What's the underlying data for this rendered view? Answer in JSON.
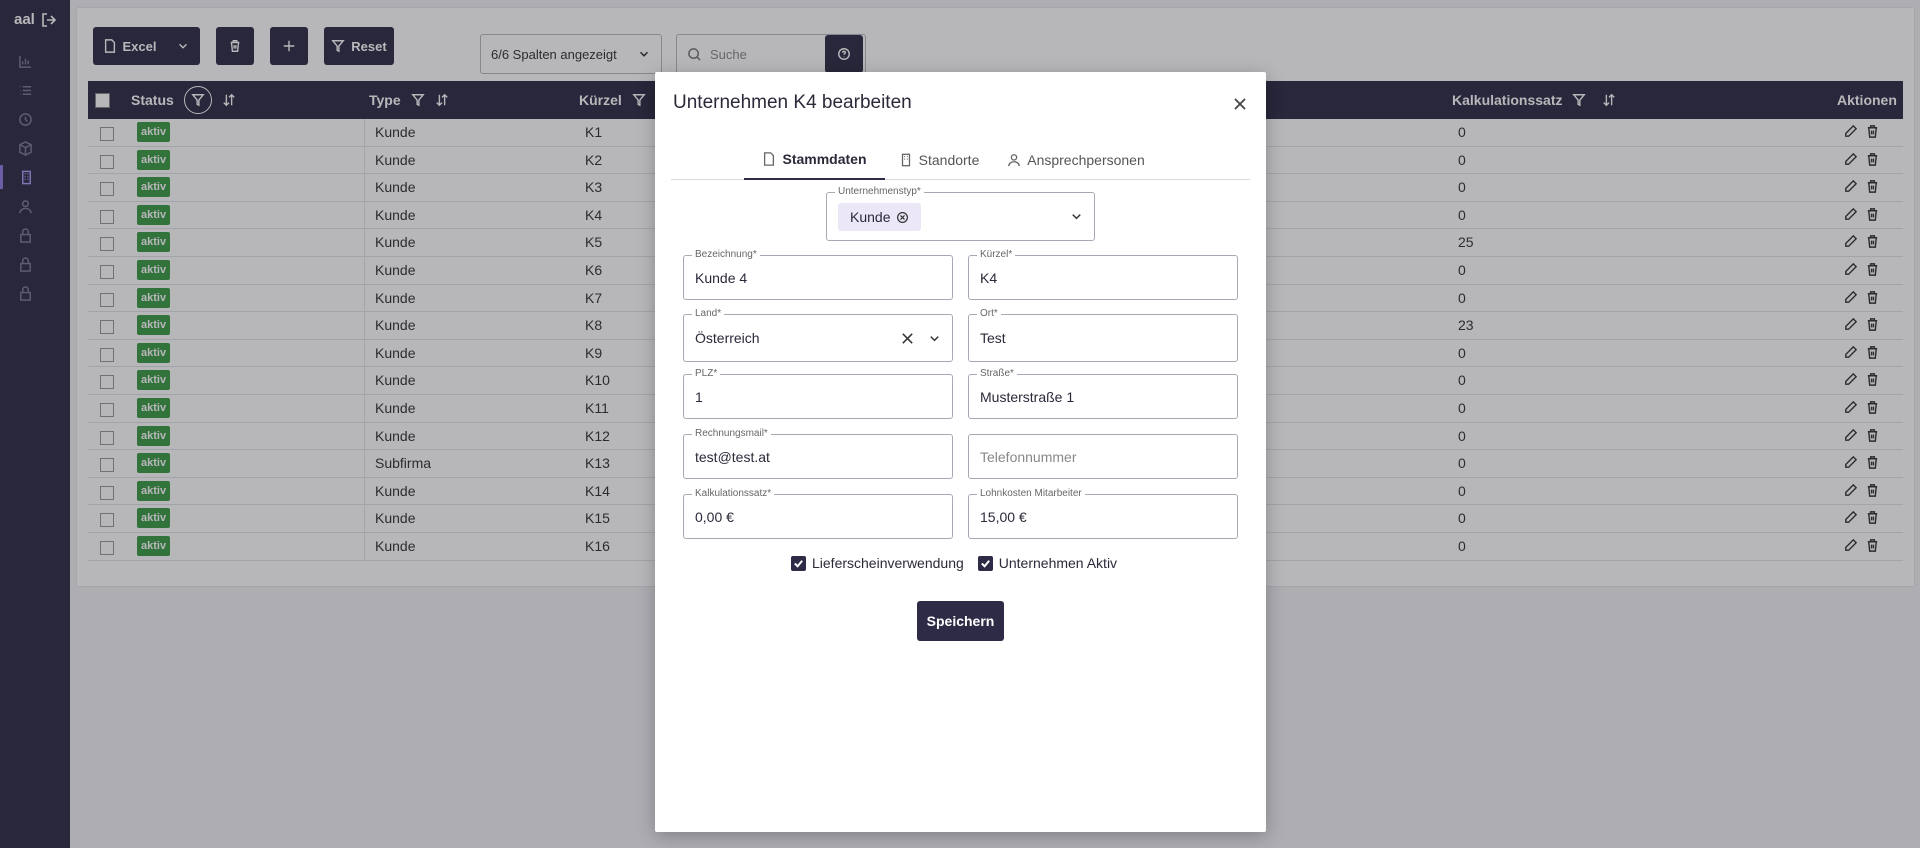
{
  "app": {
    "brand": "aal"
  },
  "sidebar": {
    "icons": [
      "chart-icon",
      "list-icon",
      "clock-icon",
      "box-icon",
      "building-icon",
      "user-icon",
      "lock-icon",
      "lock-icon",
      "lock-icon"
    ]
  },
  "toolbar": {
    "excel_label": "Excel",
    "reset_label": "Reset",
    "columns_select": "6/6 Spalten angezeigt",
    "search_placeholder": "Suche"
  },
  "table": {
    "headers": {
      "status": "Status",
      "type": "Type",
      "kuerzel": "Kürzel",
      "kalkulationssatz": "Kalkulationssatz",
      "aktionen": "Aktionen"
    },
    "rows": [
      {
        "status": "aktiv",
        "type": "Kunde",
        "kuerzel": "K1",
        "kalk": "0"
      },
      {
        "status": "aktiv",
        "type": "Kunde",
        "kuerzel": "K2",
        "kalk": "0"
      },
      {
        "status": "aktiv",
        "type": "Kunde",
        "kuerzel": "K3",
        "kalk": "0"
      },
      {
        "status": "aktiv",
        "type": "Kunde",
        "kuerzel": "K4",
        "kalk": "0"
      },
      {
        "status": "aktiv",
        "type": "Kunde",
        "kuerzel": "K5",
        "kalk": "25"
      },
      {
        "status": "aktiv",
        "type": "Kunde",
        "kuerzel": "K6",
        "kalk": "0"
      },
      {
        "status": "aktiv",
        "type": "Kunde",
        "kuerzel": "K7",
        "kalk": "0"
      },
      {
        "status": "aktiv",
        "type": "Kunde",
        "kuerzel": "K8",
        "kalk": "23"
      },
      {
        "status": "aktiv",
        "type": "Kunde",
        "kuerzel": "K9",
        "kalk": "0"
      },
      {
        "status": "aktiv",
        "type": "Kunde",
        "kuerzel": "K10",
        "kalk": "0"
      },
      {
        "status": "aktiv",
        "type": "Kunde",
        "kuerzel": "K11",
        "kalk": "0"
      },
      {
        "status": "aktiv",
        "type": "Kunde",
        "kuerzel": "K12",
        "kalk": "0"
      },
      {
        "status": "aktiv",
        "type": "Subfirma",
        "kuerzel": "K13",
        "kalk": "0"
      },
      {
        "status": "aktiv",
        "type": "Kunde",
        "kuerzel": "K14",
        "kalk": "0"
      },
      {
        "status": "aktiv",
        "type": "Kunde",
        "kuerzel": "K15",
        "kalk": "0"
      },
      {
        "status": "aktiv",
        "type": "Kunde",
        "kuerzel": "K16",
        "kalk": "0"
      }
    ]
  },
  "modal": {
    "title": "Unternehmen K4 bearbeiten",
    "tabs": [
      "Stammdaten",
      "Standorte",
      "Ansprechpersonen"
    ],
    "fields": {
      "unternehmenstyp": {
        "label": "Unternehmenstyp*",
        "chip": "Kunde"
      },
      "bezeichnung": {
        "label": "Bezeichnung*",
        "value": "Kunde 4"
      },
      "kuerzel": {
        "label": "Kürzel*",
        "value": "K4"
      },
      "land": {
        "label": "Land*",
        "value": "Österreich"
      },
      "ort": {
        "label": "Ort*",
        "value": "Test"
      },
      "plz": {
        "label": "PLZ*",
        "value": "1"
      },
      "strasse": {
        "label": "Straße*",
        "value": "Musterstraße 1"
      },
      "rechnungsmail": {
        "label": "Rechnungsmail*",
        "value": "test@test.at"
      },
      "telefonnummer": {
        "placeholder": "Telefonnummer"
      },
      "kalkulationssatz": {
        "label": "Kalkulationssatz*",
        "value": "0,00 €"
      },
      "lohnkosten": {
        "label": "Lohnkosten Mitarbeiter",
        "value": "15,00 €"
      }
    },
    "checkboxes": [
      {
        "label": "Lieferscheinverwendung",
        "checked": true
      },
      {
        "label": "Unternehmen Aktiv",
        "checked": true
      }
    ],
    "save_label": "Speichern"
  },
  "colors": {
    "primary": "#2d2b45",
    "badge": "#3b9a45",
    "accent": "#8f7de0"
  }
}
